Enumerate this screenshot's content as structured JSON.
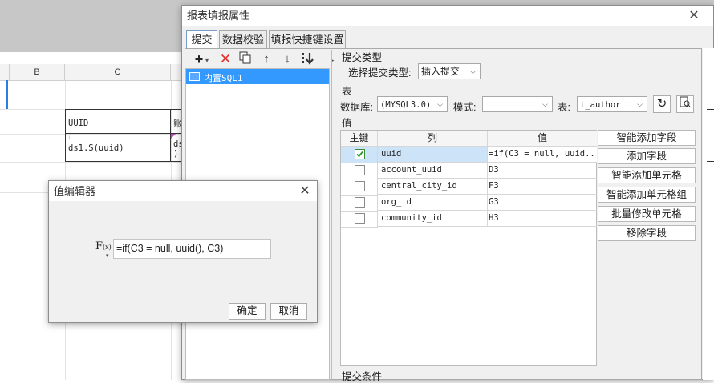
{
  "sheet": {
    "col_b": "B",
    "col_c": "C",
    "cell_c_header": "UUID",
    "cell_d_header": "账",
    "cell_c_formula": "ds1.S(uuid)",
    "cell_d_partial_top": "ds",
    "cell_d_partial_bottom": ")"
  },
  "main_dialog": {
    "title": "报表填报属性",
    "tabs": [
      "提交",
      "数据校验",
      "填报快捷键设置"
    ],
    "left_list": {
      "items": [
        "内置SQL1"
      ]
    },
    "submit_type_section": "提交类型",
    "submit_type_label": "选择提交类型:",
    "submit_type_value": "插入提交",
    "table_section": "表",
    "db_label": "数据库:",
    "db_value": "(MYSQL3.0)",
    "schema_label": "模式:",
    "schema_value": "",
    "table_label": "表:",
    "table_value": "t_author",
    "value_section": "值",
    "grid": {
      "headers": [
        "主键",
        "列",
        "值"
      ],
      "rows": [
        {
          "pk": true,
          "col": "uuid",
          "val": "=if(C3 = null, uuid..."
        },
        {
          "pk": false,
          "col": "account_uuid",
          "val": "D3"
        },
        {
          "pk": false,
          "col": "central_city_id",
          "val": "F3"
        },
        {
          "pk": false,
          "col": "org_id",
          "val": "G3"
        },
        {
          "pk": false,
          "col": "community_id",
          "val": "H3"
        }
      ]
    },
    "side_buttons": [
      "智能添加字段",
      "添加字段",
      "智能添加单元格",
      "智能添加单元格组",
      "批量修改单元格",
      "移除字段"
    ],
    "condition_section": "提交条件"
  },
  "value_editor": {
    "title": "值编辑器",
    "fx_label": "F",
    "fx_sub": "(x)",
    "formula": "=if(C3 = null, uuid(), C3)",
    "ok": "确定",
    "cancel": "取消"
  },
  "colors": {
    "accent_blue": "#3399ff",
    "selected_row": "#cde3f7",
    "list_selected": "#3399ff"
  }
}
